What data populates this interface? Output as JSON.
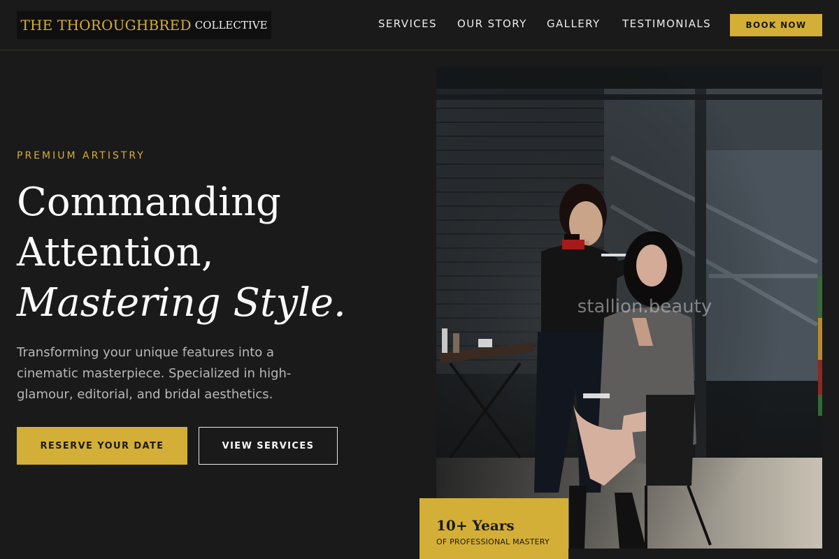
{
  "header": {
    "logo_main": "THE THOROUGHBRED",
    "logo_sub": "COLLECTIVE",
    "nav": [
      "SERVICES",
      "OUR STORY",
      "GALLERY",
      "TESTIMONIALS"
    ],
    "cta": "BOOK NOW"
  },
  "hero": {
    "eyebrow": "PREMIUM ARTISTRY",
    "headline_line1": "Commanding",
    "headline_line2": "Attention,",
    "headline_line3": "Mastering Style.",
    "subtext": "Transforming your unique features into a cinematic masterpiece. Specialized in high-glamour, editorial, and bridal aesthetics.",
    "primary_button": "RESERVE YOUR DATE",
    "secondary_button": "VIEW SERVICES",
    "image_watermark": "stallion.beauty",
    "badge_title": "10+ Years",
    "badge_sub": "OF PROFESSIONAL MASTERY"
  },
  "colors": {
    "accent": "#d4af37",
    "background": "#1a1a1a",
    "text_muted": "#b8b8b8"
  }
}
